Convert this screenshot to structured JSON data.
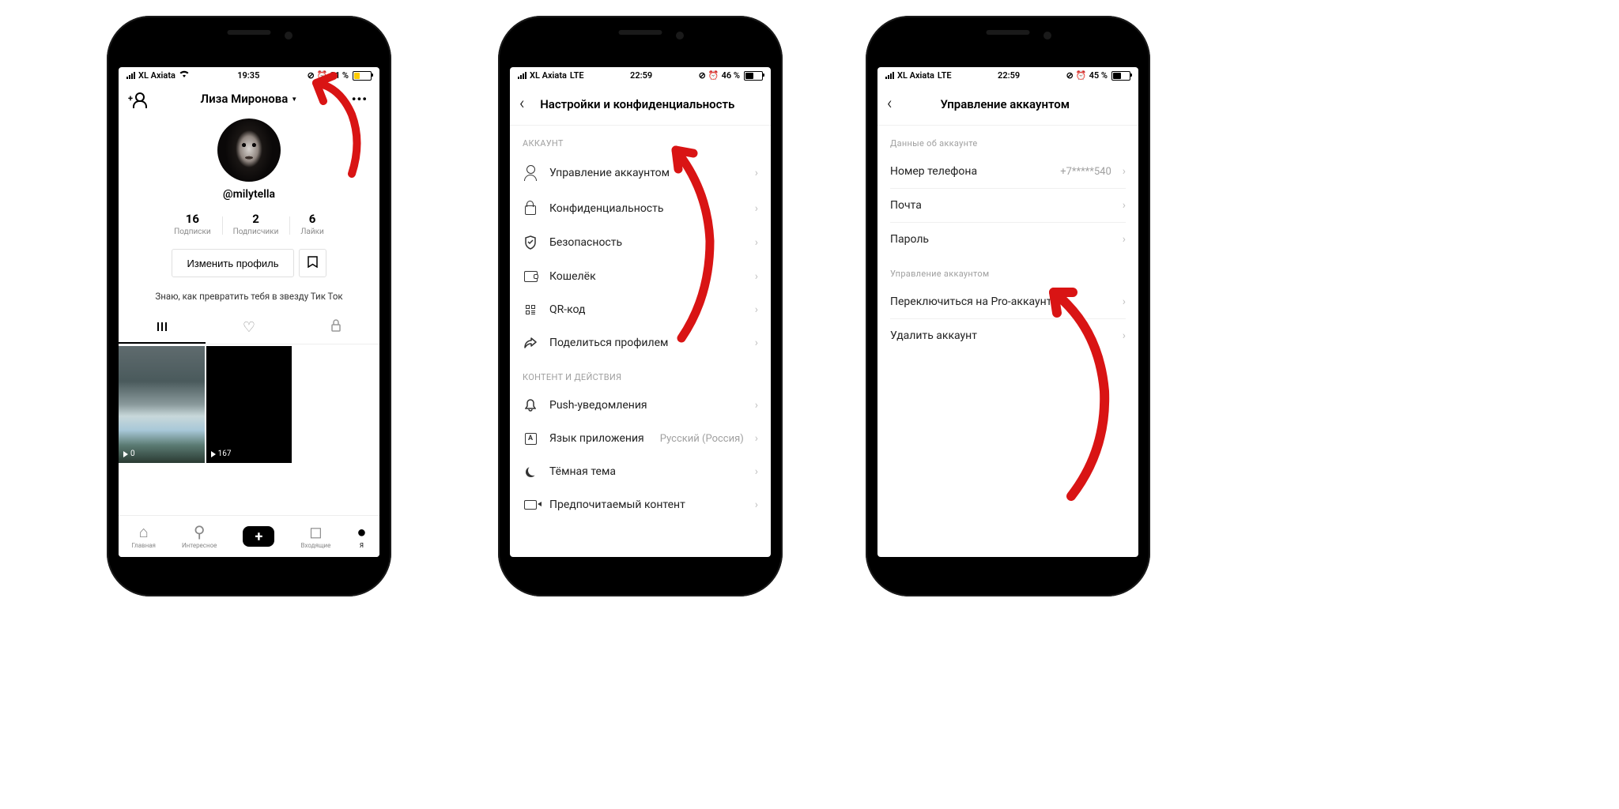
{
  "phone1": {
    "status": {
      "carrier": "XL Axiata",
      "network": "wifi",
      "time": "19:35",
      "alarm": "⏰",
      "battery_text": "31 %",
      "battery_pct": 31
    },
    "profile": {
      "display_name": "Лиза Миронова",
      "username": "@milytella",
      "bio": "Знаю, как превратить тебя в звезду Тик Ток"
    },
    "stats": {
      "following_num": "16",
      "following_label": "Подписки",
      "followers_num": "2",
      "followers_label": "Подписчики",
      "likes_num": "6",
      "likes_label": "Лайки"
    },
    "edit_button": "Изменить профиль",
    "videos": [
      {
        "plays": "0"
      },
      {
        "plays": "167"
      }
    ],
    "nav": {
      "home": "Главная",
      "discover": "Интересное",
      "inbox": "Входящие",
      "me": "Я"
    }
  },
  "phone2": {
    "status": {
      "carrier": "XL Axiata",
      "network": "LTE",
      "time": "22:59",
      "alarm": "⏰",
      "battery_text": "46 %",
      "battery_pct": 46
    },
    "title": "Настройки и конфиденциальность",
    "section1_label": "АККАУНТ",
    "rows1": {
      "manage": "Управление аккаунтом",
      "privacy": "Конфиденциальность",
      "security": "Безопасность",
      "wallet": "Кошелёк",
      "qr": "QR-код",
      "share": "Поделиться профилем"
    },
    "section2_label": "КОНТЕНТ И ДЕЙСТВИЯ",
    "rows2": {
      "push": "Push-уведомления",
      "lang": "Язык приложения",
      "lang_value": "Русский (Россия)",
      "dark": "Тёмная тема",
      "content": "Предпочитаемый контент"
    },
    "lang_letter": "A"
  },
  "phone3": {
    "status": {
      "carrier": "XL Axiata",
      "network": "LTE",
      "time": "22:59",
      "alarm": "⏰",
      "battery_text": "45 %",
      "battery_pct": 45
    },
    "title": "Управление аккаунтом",
    "section1_label": "Данные об аккаунте",
    "rows1": {
      "phone_label": "Номер телефона",
      "phone_value": "+7*****540",
      "email": "Почта",
      "password": "Пароль"
    },
    "section2_label": "Управление аккаунтом",
    "rows2": {
      "switch_pro": "Переключиться на Pro-аккаунт",
      "delete": "Удалить аккаунт"
    }
  }
}
